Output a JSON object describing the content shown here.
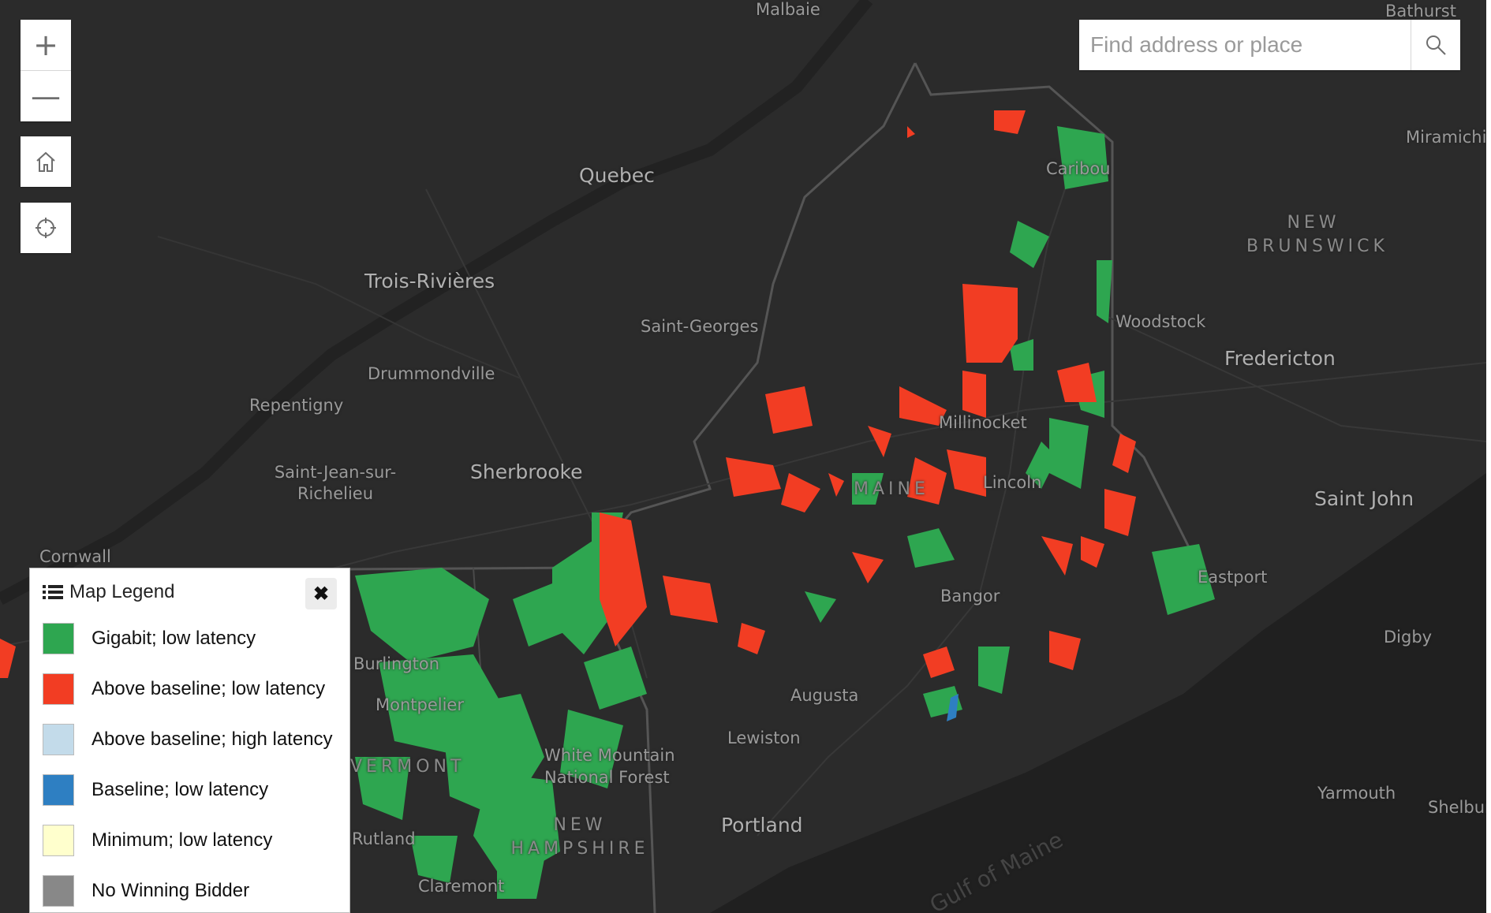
{
  "search": {
    "placeholder": "Find address or place"
  },
  "controls": {
    "zoom_in": "+",
    "zoom_out": "—"
  },
  "legend": {
    "title": "Map Legend",
    "close": "✖",
    "items": [
      {
        "label": "Gigabit; low latency",
        "color": "#2ea650"
      },
      {
        "label": "Above baseline; low latency",
        "color": "#f23d23"
      },
      {
        "label": "Above baseline; high latency",
        "color": "#c3dbea"
      },
      {
        "label": "Baseline; low latency",
        "color": "#2e7fc2"
      },
      {
        "label": "Minimum; low latency",
        "color": "#ffffcd"
      },
      {
        "label": "No Winning Bidder",
        "color": "#888888"
      }
    ]
  },
  "places": {
    "malbaie": "Malbaie",
    "bathurst": "Bathurst",
    "miramichi": "Miramichi",
    "quebec": "Quebec",
    "caribou": "Caribou",
    "new_brunswick": "NEW BRUNSWICK",
    "trois_rivieres": "Trois-Rivières",
    "saint_georges": "Saint-Georges",
    "woodstock": "Woodstock",
    "fredericton": "Fredericton",
    "drummondville": "Drummondville",
    "repentigny": "Repentigny",
    "millinocket": "Millinocket",
    "saint_jean": "Saint-Jean-sur-Richelieu",
    "sherbrooke": "Sherbrooke",
    "maine": "MAINE",
    "lincoln": "Lincoln",
    "saint_john": "Saint John",
    "cornwall": "Cornwall",
    "eastport": "Eastport",
    "bangor": "Bangor",
    "digby": "Digby",
    "augusta": "Augusta",
    "montpelier": "Montpelier",
    "lewiston": "Lewiston",
    "vermont": "VERMONT",
    "white_mountain": "White Mountain National Forest",
    "yarmouth": "Yarmouth",
    "shelburne": "Shelburne",
    "new_hampshire": "NEW HAMPSHIRE",
    "portland": "Portland",
    "rutland": "Rutland",
    "claremont": "Claremont",
    "burlington": "Burlington",
    "gulf_of_maine": "Gulf of Maine"
  }
}
